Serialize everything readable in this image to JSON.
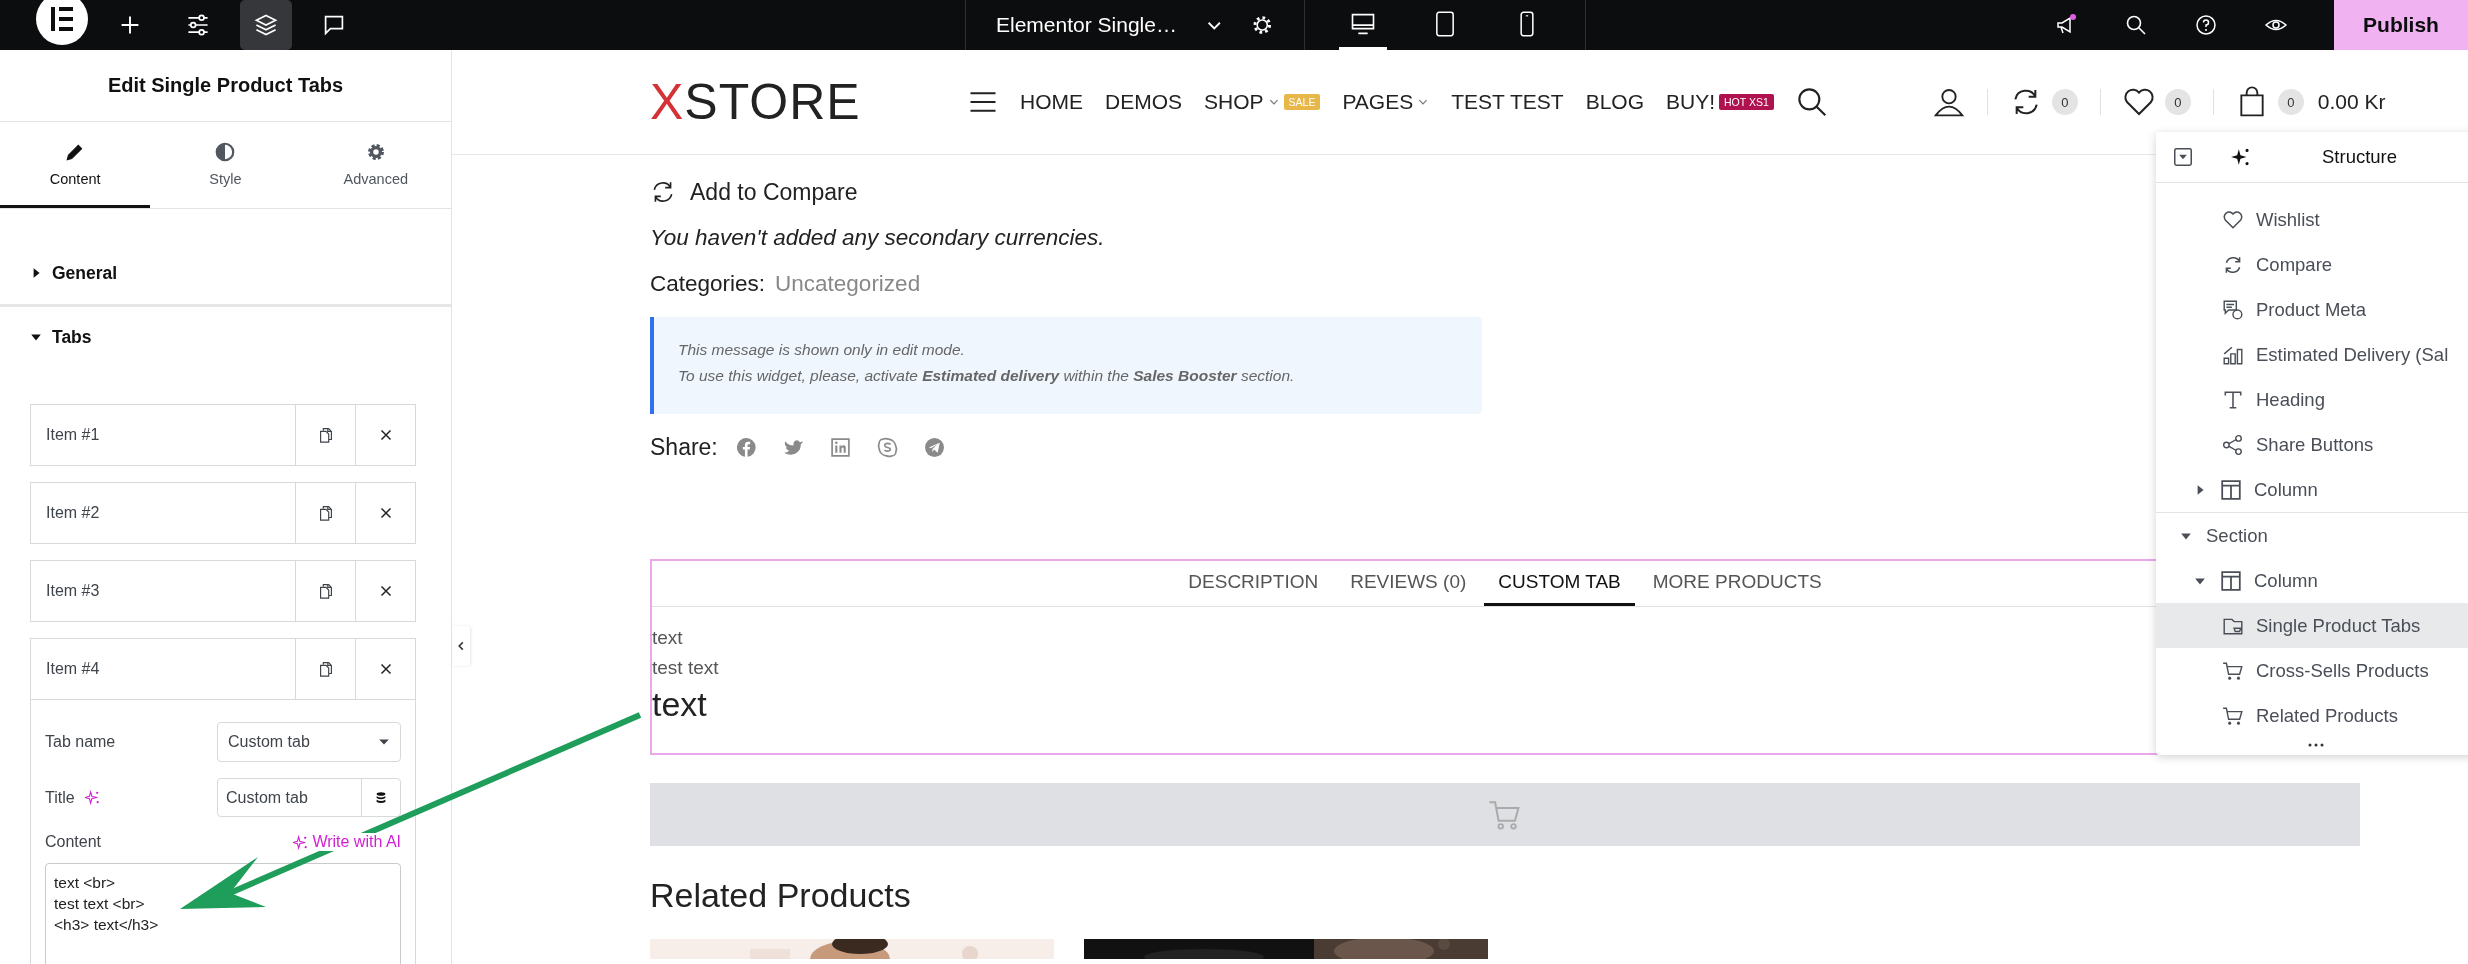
{
  "topbar": {
    "tools": [
      {
        "selected": false
      },
      {
        "selected": false
      },
      {
        "selected": false
      },
      {
        "selected": true
      },
      {
        "selected": false
      }
    ],
    "document_title": "Elementor Single…",
    "devices": [
      {
        "selected": true
      },
      {
        "selected": false
      },
      {
        "selected": false
      }
    ],
    "notification_dot": true,
    "publish": "Publish"
  },
  "panel": {
    "title": "Edit Single Product Tabs",
    "tabs": [
      {
        "label": "Content",
        "selected": true
      },
      {
        "label": "Style",
        "selected": false
      },
      {
        "label": "Advanced",
        "selected": false
      }
    ],
    "sections": [
      {
        "label": "General",
        "expanded": false
      },
      {
        "label": "Tabs",
        "expanded": true
      }
    ],
    "items": [
      {
        "label": "Item #1",
        "expanded": false
      },
      {
        "label": "Item #2",
        "expanded": false
      },
      {
        "label": "Item #3",
        "expanded": false
      },
      {
        "label": "Item #4",
        "expanded": true
      }
    ],
    "item_form": {
      "tab_name_label": "Tab name",
      "tab_name_value": "Custom tab",
      "title_label": "Title",
      "title_value": "Custom tab",
      "content_label": "Content",
      "ai_link": "Write with AI",
      "content": "text <br>\ntest text <br>\n<h3> text</h3>"
    }
  },
  "site_header": {
    "logo": "XSTORE",
    "nav": [
      {
        "label": "HOME",
        "dropdown": false
      },
      {
        "label": "DEMOS",
        "dropdown": false
      },
      {
        "label": "SHOP",
        "dropdown": true,
        "badge": "SALE",
        "color": "#e7b74a"
      },
      {
        "label": "PAGES",
        "dropdown": true
      },
      {
        "label": "TEST TEST",
        "dropdown": false
      },
      {
        "label": "BLOG",
        "dropdown": false
      },
      {
        "label": "BUY!",
        "dropdown": false,
        "badge": "HOT XS1",
        "color": "#b0124f"
      }
    ],
    "compare_count": "0",
    "wishlist_count": "0",
    "cart_count": "0",
    "cart_total": "0.00 Kr"
  },
  "product": {
    "compare_label": "Add to Compare",
    "currency_note": "You haven't added any secondary currencies.",
    "categories_label": "Categories:",
    "category": "Uncategorized",
    "notice": [
      "This message is shown only in edit mode.",
      "To use this widget, please, activate **Estimated delivery** within the **Sales Booster** section."
    ],
    "share_label": "Share:"
  },
  "product_tabs": {
    "tabs": [
      {
        "label": "DESCRIPTION",
        "selected": false
      },
      {
        "label": "REVIEWS (0)",
        "selected": false
      },
      {
        "label": "CUSTOM TAB",
        "selected": true
      },
      {
        "label": "MORE PRODUCTS",
        "selected": false
      }
    ],
    "lines": [
      "text",
      "test text"
    ],
    "heading": "text"
  },
  "related": {
    "title": "Related Products"
  },
  "structure": {
    "title": "Structure",
    "tree": [
      {
        "children": [
          {
            "children": [
              {
                "label": "Wishlist",
                "kind": "heart",
                "selected": false
              },
              {
                "label": "Compare",
                "kind": "compare",
                "selected": false
              },
              {
                "label": "Product Meta",
                "kind": "meta",
                "selected": false
              },
              {
                "label": "Estimated Delivery (Sal",
                "kind": "chart",
                "selected": false
              },
              {
                "label": "Heading",
                "kind": "heading",
                "selected": false
              },
              {
                "label": "Share Buttons",
                "kind": "share",
                "selected": false
              }
            ]
          },
          {
            "label": "Column",
            "kind": "column",
            "expanded": false,
            "selected": false
          }
        ]
      },
      {
        "label": "Section",
        "expanded": true,
        "selected": false,
        "children": [
          {
            "label": "Column",
            "kind": "column",
            "expanded": true,
            "selected": false,
            "children": [
              {
                "label": "Single Product Tabs",
                "kind": "tabs",
                "selected": true
              },
              {
                "label": "Cross-Sells Products",
                "kind": "cart",
                "selected": false
              },
              {
                "label": "Related Products",
                "kind": "cart",
                "selected": false
              }
            ]
          }
        ]
      }
    ]
  }
}
